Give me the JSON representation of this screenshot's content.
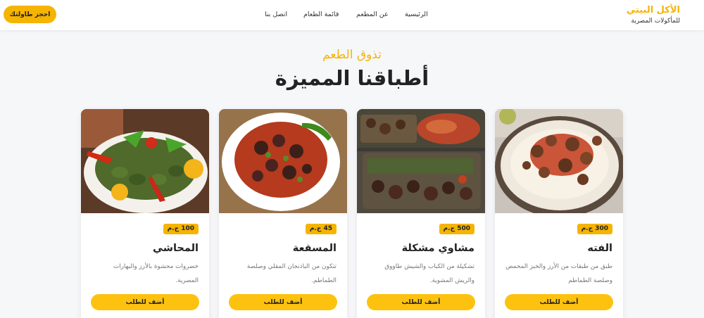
{
  "header": {
    "brand_name": "الأكل البيتي",
    "brand_subtitle": "للمأكولات المصرية",
    "nav": {
      "home": "الرئيسية",
      "about": "عن المطعم",
      "menu": "قائمة الطعام",
      "contact": "اتصل بنا"
    },
    "reserve_label": "احجز طاولتك"
  },
  "section": {
    "eyebrow": "تذوق الطعم",
    "title": "أطباقنا المميزة"
  },
  "dishes": [
    {
      "name": "الفته",
      "price": "300 ج.م",
      "desc": "طبق من طبقات من الأرز والخبز المحمص وصلصة الطماطم",
      "order_label": "أضف للطلب"
    },
    {
      "name": "مشاوي مشكلة",
      "price": "500 ج.م",
      "desc": "تشكيلة من الكباب والشيش طاووق والريش المشوية.",
      "order_label": "أضف للطلب"
    },
    {
      "name": "المسقعة",
      "price": "45 ج.م",
      "desc": "تتكون من الباذنجان المقلي وصلصة الطماطم.",
      "order_label": "أضف للطلب"
    },
    {
      "name": "المحاشي",
      "price": "100 ج.م",
      "desc": "خضروات محشوة بالأرز والبهارات المصرية.",
      "order_label": "أضف للطلب"
    }
  ],
  "colors": {
    "accent": "#f5b400",
    "button": "#fdc20f",
    "page_bg": "#f6f7f9"
  }
}
